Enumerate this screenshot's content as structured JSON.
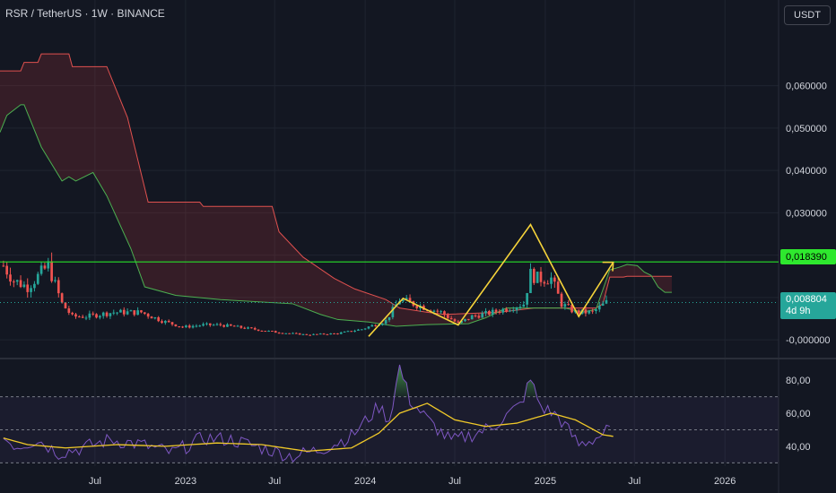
{
  "header": {
    "symbol": "RSR / TetherUS · 1W · BINANCE"
  },
  "currency_button": {
    "label": "USDT"
  },
  "price_tags": {
    "resistance": "0,018390",
    "last_price": "0,008804",
    "countdown": "4d 9h"
  },
  "colors": {
    "background": "#131722",
    "grid": "#1f2430",
    "up": "#26a69a",
    "down": "#ef5350",
    "resistance": "#26e029",
    "pattern": "#f5d33a",
    "rsi": "#7e57c2",
    "rsi_ma": "#f0c929",
    "cloud_upper": "#e0514f",
    "cloud_lower": "#4caf50"
  },
  "chart_data": [
    {
      "type": "candlestick",
      "title": "",
      "ylim": [
        -0.004,
        0.076
      ],
      "y_ticks": [
        "0,060000",
        "0,050000",
        "0,040000",
        "0,030000",
        "0,020000",
        "0,010000",
        "-0,000000"
      ],
      "y_tick_values": [
        0.06,
        0.05,
        0.04,
        0.03,
        0.02,
        0.01,
        0.0
      ],
      "x_ticks": [
        "Jul",
        "2023",
        "Jul",
        "2024",
        "Jul",
        "2025",
        "Jul",
        "2026"
      ],
      "x_tick_dates": [
        "2022-07-01",
        "2023-01-01",
        "2023-07-01",
        "2024-01-01",
        "2024-07-01",
        "2025-01-01",
        "2025-07-01",
        "2026-01-01"
      ],
      "x_range": [
        "2021-12-20",
        "2026-04-20"
      ],
      "resistance_level": 0.01839,
      "last_price": 0.008804,
      "anchors": [
        [
          "2021-12-27",
          0.0175
        ],
        [
          "2022-01-17",
          0.014
        ],
        [
          "2022-02-14",
          0.0125
        ],
        [
          "2022-03-28",
          0.0175
        ],
        [
          "2022-04-25",
          0.0085
        ],
        [
          "2022-05-16",
          0.0055
        ],
        [
          "2022-06-13",
          0.0055
        ],
        [
          "2022-08-08",
          0.0065
        ],
        [
          "2022-10-03",
          0.0065
        ],
        [
          "2022-11-14",
          0.0045
        ],
        [
          "2022-12-26",
          0.003
        ],
        [
          "2023-02-06",
          0.0035
        ],
        [
          "2023-03-13",
          0.0035
        ],
        [
          "2023-05-01",
          0.0028
        ],
        [
          "2023-07-03",
          0.0018
        ],
        [
          "2023-09-04",
          0.0012
        ],
        [
          "2023-11-06",
          0.0015
        ],
        [
          "2023-12-25",
          0.0025
        ],
        [
          "2024-02-12",
          0.0045
        ],
        [
          "2024-03-11",
          0.0095
        ],
        [
          "2024-04-08",
          0.0085
        ],
        [
          "2024-06-03",
          0.0065
        ],
        [
          "2024-07-08",
          0.0038
        ],
        [
          "2024-08-05",
          0.0055
        ],
        [
          "2024-09-16",
          0.0065
        ],
        [
          "2024-11-18",
          0.0085
        ],
        [
          "2024-12-02",
          0.0155
        ],
        [
          "2024-12-16",
          0.0145
        ],
        [
          "2025-01-13",
          0.0145
        ],
        [
          "2025-02-03",
          0.0085
        ],
        [
          "2025-03-03",
          0.0065
        ],
        [
          "2025-04-07",
          0.0065
        ],
        [
          "2025-05-05",
          0.0088
        ]
      ],
      "cloud_upper": [
        [
          "2021-12-20",
          0.0635
        ],
        [
          "2022-01-31",
          0.0635
        ],
        [
          "2022-02-07",
          0.0655
        ],
        [
          "2022-03-07",
          0.0655
        ],
        [
          "2022-03-14",
          0.0675
        ],
        [
          "2022-05-09",
          0.0675
        ],
        [
          "2022-05-16",
          0.0645
        ],
        [
          "2022-07-25",
          0.0645
        ],
        [
          "2022-09-05",
          0.0525
        ],
        [
          "2022-10-17",
          0.0325
        ],
        [
          "2023-01-30",
          0.0325
        ],
        [
          "2023-02-06",
          0.0315
        ],
        [
          "2023-06-26",
          0.0315
        ],
        [
          "2023-07-10",
          0.0255
        ],
        [
          "2023-08-28",
          0.0195
        ],
        [
          "2023-10-30",
          0.0145
        ],
        [
          "2023-12-11",
          0.012
        ],
        [
          "2024-02-12",
          0.0095
        ],
        [
          "2024-03-11",
          0.0075
        ],
        [
          "2024-05-06",
          0.0065
        ],
        [
          "2024-06-10",
          0.006
        ],
        [
          "2024-09-30",
          0.0065
        ],
        [
          "2024-12-09",
          0.0075
        ],
        [
          "2025-03-03",
          0.0075
        ],
        [
          "2025-04-14",
          0.0075
        ],
        [
          "2025-04-28",
          0.0085
        ],
        [
          "2025-05-12",
          0.0148
        ],
        [
          "2025-06-09",
          0.0148
        ],
        [
          "2025-06-16",
          0.015
        ],
        [
          "2025-07-21",
          0.015
        ],
        [
          "2025-09-15",
          0.015
        ]
      ],
      "cloud_lower": [
        [
          "2021-12-20",
          0.049
        ],
        [
          "2022-01-03",
          0.053
        ],
        [
          "2022-01-31",
          0.0555
        ],
        [
          "2022-02-07",
          0.0555
        ],
        [
          "2022-03-14",
          0.0455
        ],
        [
          "2022-04-25",
          0.0375
        ],
        [
          "2022-05-09",
          0.0385
        ],
        [
          "2022-05-23",
          0.0375
        ],
        [
          "2022-06-27",
          0.0395
        ],
        [
          "2022-07-25",
          0.034
        ],
        [
          "2022-09-12",
          0.0215
        ],
        [
          "2022-10-10",
          0.0125
        ],
        [
          "2022-12-12",
          0.0105
        ],
        [
          "2023-03-13",
          0.0095
        ],
        [
          "2023-08-07",
          0.0085
        ],
        [
          "2023-10-02",
          0.006
        ],
        [
          "2023-11-06",
          0.0048
        ],
        [
          "2024-01-08",
          0.0042
        ],
        [
          "2024-03-04",
          0.0032
        ],
        [
          "2024-05-06",
          0.0036
        ],
        [
          "2024-07-29",
          0.0038
        ],
        [
          "2024-09-02",
          0.0052
        ],
        [
          "2024-10-14",
          0.0075
        ],
        [
          "2024-12-02",
          0.0075
        ],
        [
          "2025-02-10",
          0.0075
        ],
        [
          "2025-03-17",
          0.0065
        ],
        [
          "2025-04-14",
          0.0072
        ],
        [
          "2025-05-12",
          0.0165
        ],
        [
          "2025-06-02",
          0.0172
        ],
        [
          "2025-06-16",
          0.0178
        ],
        [
          "2025-07-07",
          0.0175
        ],
        [
          "2025-07-21",
          0.016
        ],
        [
          "2025-08-04",
          0.0152
        ],
        [
          "2025-08-18",
          0.0125
        ],
        [
          "2025-09-01",
          0.0112
        ],
        [
          "2025-09-15",
          0.0112
        ]
      ],
      "pattern_lines": [
        [
          [
            "2024-01-08",
            0.0008
          ],
          [
            "2024-03-18",
            0.0098
          ],
          [
            "2024-07-08",
            0.0035
          ],
          [
            "2024-12-02",
            0.0272
          ],
          [
            "2025-03-10",
            0.0055
          ],
          [
            "2025-05-19",
            0.0183
          ]
        ]
      ]
    },
    {
      "type": "line",
      "title": "",
      "ylim": [
        28,
        92
      ],
      "y_ticks": [
        "80,00",
        "60,00",
        "40,00"
      ],
      "y_tick_values": [
        80,
        60,
        40
      ],
      "bands": [
        70,
        50,
        30
      ],
      "rsi_anchors": [
        [
          "2021-12-27",
          45
        ],
        [
          "2022-01-24",
          40
        ],
        [
          "2022-03-07",
          44
        ],
        [
          "2022-04-18",
          36
        ],
        [
          "2022-06-06",
          39
        ],
        [
          "2022-08-01",
          44
        ],
        [
          "2022-10-03",
          41
        ],
        [
          "2022-12-05",
          36
        ],
        [
          "2023-02-06",
          45
        ],
        [
          "2023-04-03",
          44
        ],
        [
          "2023-06-05",
          39
        ],
        [
          "2023-08-07",
          34
        ],
        [
          "2023-10-02",
          38
        ],
        [
          "2023-12-04",
          46
        ],
        [
          "2024-01-29",
          64
        ],
        [
          "2024-02-19",
          56
        ],
        [
          "2024-03-11",
          88
        ],
        [
          "2024-04-01",
          68
        ],
        [
          "2024-05-13",
          54
        ],
        [
          "2024-06-24",
          43
        ],
        [
          "2024-08-05",
          47
        ],
        [
          "2024-09-16",
          52
        ],
        [
          "2024-11-11",
          65
        ],
        [
          "2024-12-02",
          80
        ],
        [
          "2024-12-23",
          64
        ],
        [
          "2025-01-27",
          58
        ],
        [
          "2025-03-10",
          41
        ],
        [
          "2025-04-14",
          45
        ],
        [
          "2025-05-12",
          50
        ]
      ],
      "ma_anchors": [
        [
          "2021-12-27",
          45
        ],
        [
          "2022-02-14",
          41
        ],
        [
          "2022-05-02",
          39
        ],
        [
          "2022-08-15",
          41
        ],
        [
          "2022-11-21",
          40
        ],
        [
          "2023-03-06",
          42
        ],
        [
          "2023-06-05",
          41
        ],
        [
          "2023-09-04",
          37
        ],
        [
          "2023-12-04",
          39
        ],
        [
          "2024-01-29",
          48
        ],
        [
          "2024-03-11",
          60
        ],
        [
          "2024-05-06",
          66
        ],
        [
          "2024-07-01",
          56
        ],
        [
          "2024-09-02",
          52
        ],
        [
          "2024-11-04",
          54
        ],
        [
          "2025-01-13",
          60
        ],
        [
          "2025-03-03",
          56
        ],
        [
          "2025-04-28",
          47
        ],
        [
          "2025-05-19",
          46
        ]
      ]
    }
  ]
}
